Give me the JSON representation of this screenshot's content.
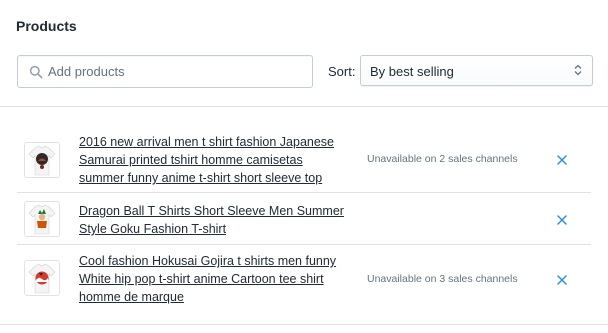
{
  "panel": {
    "title": "Products"
  },
  "search": {
    "placeholder": "Add products",
    "value": "",
    "icon": "search-icon"
  },
  "sort": {
    "label": "Sort:",
    "selected": "By best selling"
  },
  "products": [
    {
      "title": "2016 new arrival men t shirt fashion Japanese Samurai printed tshirt homme camisetas summer funny anime t-shirt short sleeve top",
      "status": "Unavailable on 2 sales channels"
    },
    {
      "title": "Dragon Ball T Shirts Short Sleeve Men Summer Style Goku Fashion T-shirt",
      "status": ""
    },
    {
      "title": "Cool fashion Hokusai Gojira t shirts men funny White hip pop t-shirt anime Cartoon tee shirt homme de marque",
      "status": "Unavailable on 3 sales channels"
    }
  ],
  "colors": {
    "accent": "#5c6ac4",
    "border": "#dfe3e8",
    "text": "#212b36",
    "subdued": "#637381"
  }
}
